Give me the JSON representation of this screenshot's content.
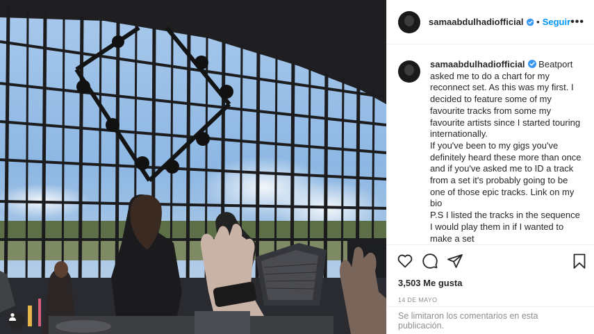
{
  "post": {
    "username": "samaabdulhadiofficial",
    "follow_label": "Seguir",
    "separator": "•",
    "more_label": "•••",
    "caption_paragraphs": [
      "Beatport asked me to do a chart for my reconnect set. As this was my first. I decided to feature some of my favourite tracks from some my favourite artists since I started touring internationally.",
      "If you've been to my gigs you've definitely heard these more than once and if you've asked me to ID a track from a set it's probably going to be one of those epic tracks. Link on my bio",
      "P.S I listed the tracks in the sequence I would play them in if I wanted to make a set"
    ],
    "likes": "3,503 Me gusta",
    "date": "14 DE MAYO",
    "comments_disabled": "Se limitaron los comentarios en esta publicación."
  },
  "icons": {
    "like": "heart-icon",
    "comment": "comment-icon",
    "share": "share-icon",
    "save": "bookmark-icon",
    "verified": "verified-badge-icon",
    "user_tag": "user-tag-icon"
  },
  "colors": {
    "accent": "#0095f6",
    "text": "#262626",
    "muted": "#8e8e8e",
    "border": "#efefef"
  }
}
